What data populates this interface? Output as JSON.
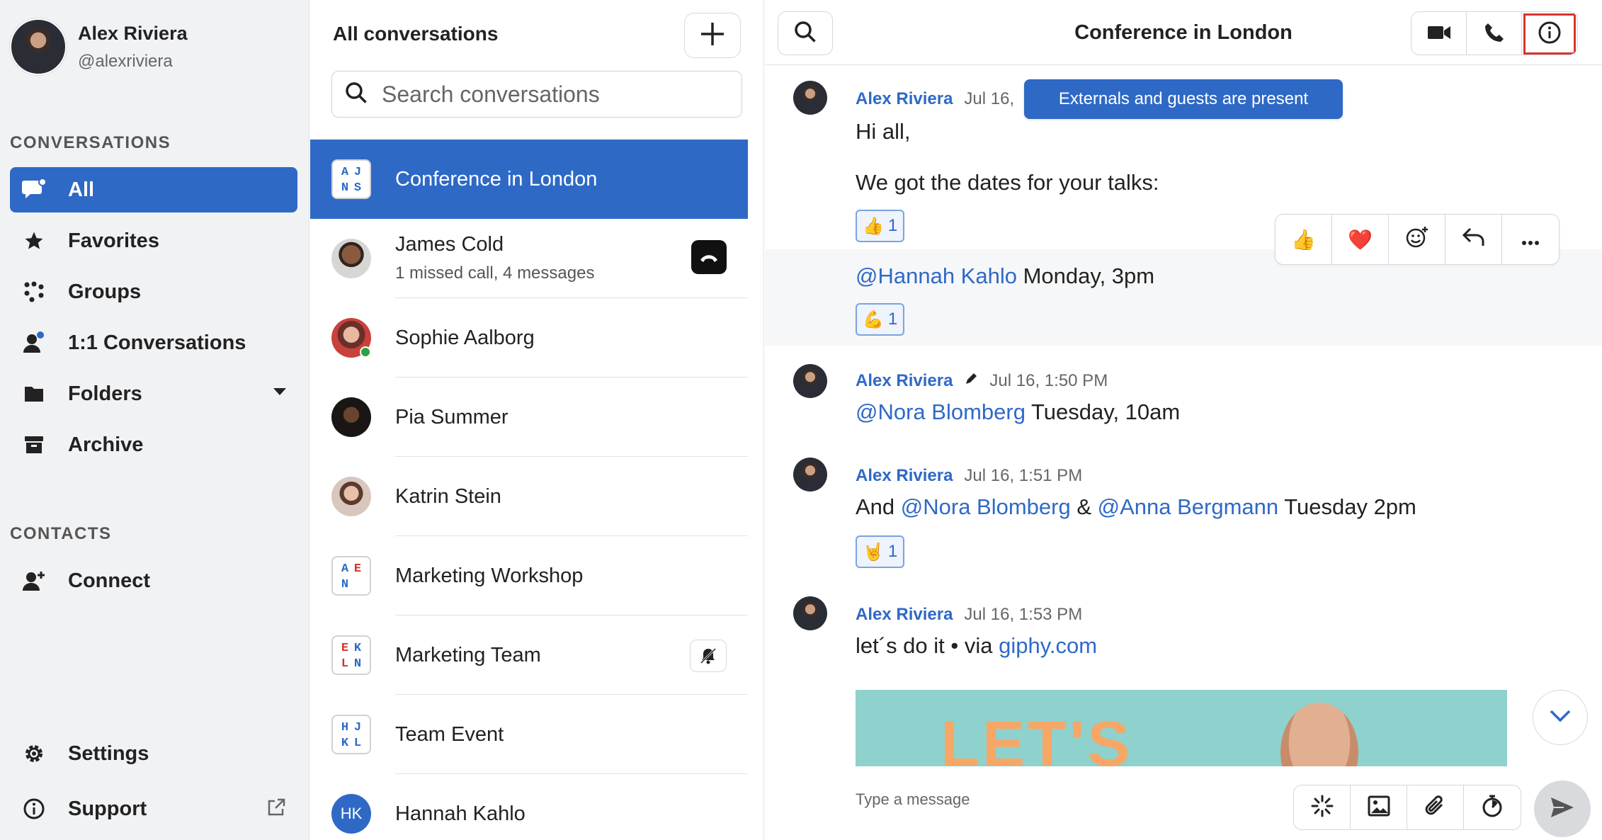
{
  "profile": {
    "name": "Alex Riviera",
    "handle": "@alexriviera"
  },
  "sidebar": {
    "conversations_title": "CONVERSATIONS",
    "contacts_title": "CONTACTS",
    "items": [
      {
        "label": "All",
        "icon": "chat-bubble-icon"
      },
      {
        "label": "Favorites",
        "icon": "star-icon"
      },
      {
        "label": "Groups",
        "icon": "groups-icon"
      },
      {
        "label": "1:1 Conversations",
        "icon": "person-icon"
      },
      {
        "label": "Folders",
        "icon": "folder-icon"
      },
      {
        "label": "Archive",
        "icon": "archive-icon"
      }
    ],
    "connect_label": "Connect",
    "settings_label": "Settings",
    "support_label": "Support"
  },
  "list": {
    "title": "All conversations",
    "search_placeholder": "Search conversations",
    "conversations": [
      {
        "name": "Conference in London",
        "initials": [
          "A",
          "J",
          "N",
          "S"
        ]
      },
      {
        "name": "James Cold",
        "sub": "1 missed call, 4 messages"
      },
      {
        "name": "Sophie Aalborg"
      },
      {
        "name": "Pia Summer"
      },
      {
        "name": "Katrin Stein"
      },
      {
        "name": "Marketing Workshop",
        "initials": [
          "A",
          "E",
          "N",
          ""
        ]
      },
      {
        "name": "Marketing Team",
        "initials": [
          "E",
          "K",
          "L",
          "N"
        ]
      },
      {
        "name": "Team Event",
        "initials": [
          "H",
          "J",
          "K",
          "L"
        ]
      },
      {
        "name": "Hannah Kahlo",
        "initials_text": "HK"
      }
    ]
  },
  "chat": {
    "title": "Conference in London",
    "banner": "Externals and guests are present",
    "messages": [
      {
        "author": "Alex Riviera",
        "time": "Jul 16,",
        "line1": "Hi all,",
        "line2": "We got the dates for your talks:",
        "reaction_emoji": "👍",
        "reaction_count": "1",
        "line3_mention": "@Hannah Kahlo",
        "line3_rest": " Monday, 3pm",
        "reaction2_emoji": "💪",
        "reaction2_count": "1"
      },
      {
        "author": "Alex Riviera",
        "time": "Jul 16, 1:50 PM",
        "mention": "@Nora Blomberg",
        "rest": " Tuesday, 10am"
      },
      {
        "author": "Alex Riviera",
        "time": "Jul 16, 1:51 PM",
        "pre": "And ",
        "mention1": "@Nora Blomberg",
        "mid": " & ",
        "mention2": "@Anna Bergmann",
        "rest": " Tuesday 2pm",
        "reaction_emoji": "🤘",
        "reaction_count": "1"
      },
      {
        "author": "Alex Riviera",
        "time": "Jul 16, 1:53 PM",
        "text": "let´s do it • via ",
        "link": "giphy.com",
        "gif_text": "LET'S"
      }
    ],
    "tools": {
      "thumbs": "👍",
      "heart": "❤️"
    },
    "composer_placeholder": "Type a message"
  }
}
